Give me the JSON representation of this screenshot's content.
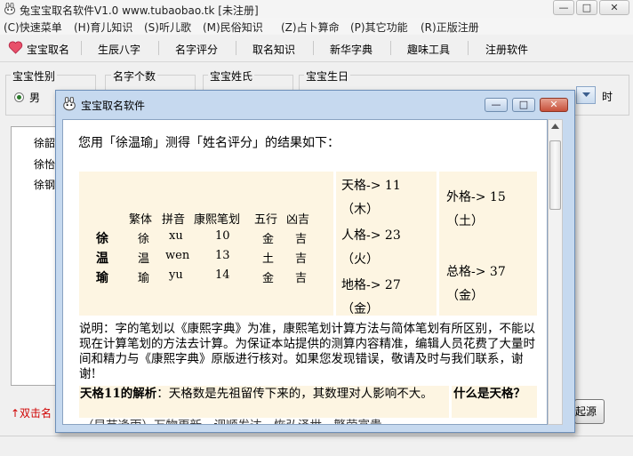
{
  "window": {
    "title": "兔宝宝取名软件V1.0 www.tubaobao.tk  [未注册]",
    "minimize": "—",
    "maximize": "□",
    "close": "✕"
  },
  "menu": [
    "(C)快速菜单",
    "(H)育儿知识",
    "(S)听儿歌",
    "(M)民俗知识",
    "(Z)占卜算命",
    "(P)其它功能",
    "(R)正版注册"
  ],
  "toolbar": [
    "宝宝取名",
    "生辰八字",
    "名字评分",
    "取名知识",
    "新华字典",
    "趣味工具",
    "注册软件"
  ],
  "form": {
    "gender_label": "宝宝性别",
    "gender_value": "男",
    "count_label": "名字个数",
    "surname_label": "宝宝姓氏",
    "birthday_label": "宝宝生日",
    "hour_suffix": "时"
  },
  "name_list": [
    "徐韶",
    "徐怡",
    "徐钢"
  ],
  "bottom": {
    "hint": "↑双击名",
    "right_button": "起源"
  },
  "dialog": {
    "title": "宝宝取名软件",
    "intro": "您用「徐温瑜」测得「姓名评分」的结果如下：",
    "table_header": [
      "繁体",
      "拼音",
      "康熙笔划",
      "五行",
      "凶吉"
    ],
    "chars": [
      {
        "char": "徐",
        "trad": "徐",
        "pinyin": "xu",
        "strokes": "10",
        "element": "金",
        "luck": "吉"
      },
      {
        "char": "温",
        "trad": "温",
        "pinyin": "wen",
        "strokes": "13",
        "element": "土",
        "luck": "吉"
      },
      {
        "char": "瑜",
        "trad": "瑜",
        "pinyin": "yu",
        "strokes": "14",
        "element": "金",
        "luck": "吉"
      }
    ],
    "grids_mid": [
      {
        "label": "天格-> 11",
        "element": "（木）"
      },
      {
        "label": "人格-> 23",
        "element": "（火）"
      },
      {
        "label": "地格-> 27",
        "element": "（金）"
      }
    ],
    "grids_right": [
      {
        "label": "外格-> 15",
        "element": "（土）"
      },
      {
        "label": "总格-> 37",
        "element": "（金）"
      }
    ],
    "note": "说明：字的笔划以《康熙字典》为准，康熙笔划计算方法与简体笔划有所区别，不能以现在计算笔划的方法去计算。为保证本站提供的测算内容精准，编辑人员花费了大量时间和精力与《康熙字典》原版进行核对。如果您发现错误，敬请及时与我们联系，谢谢!",
    "analysis_title": "天格11的解析",
    "analysis_text": "：天格数是先祖留传下来的，其数理对人影响不大。",
    "side_question": "什么是天格？",
    "cut_text": "（早苗逢雨）万物更新，调顺发达，恢弘泽世，繁荣富贵"
  }
}
